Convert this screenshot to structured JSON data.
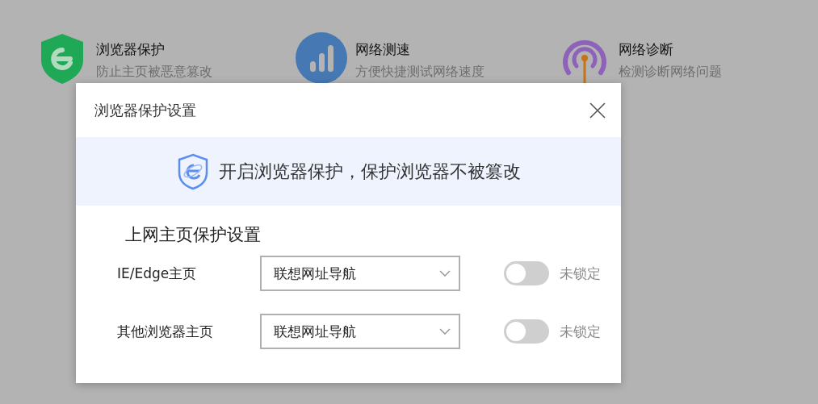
{
  "features": [
    {
      "kind": "shield",
      "title": "浏览器保护",
      "subtitle": "防止主页被恶意篡改"
    },
    {
      "kind": "speed",
      "title": "网络测速",
      "subtitle": "方便快捷测试网络速度"
    },
    {
      "kind": "signal",
      "title": "网络诊断",
      "subtitle": "检测诊断网络问题"
    }
  ],
  "dialog": {
    "title": "浏览器保护设置",
    "banner": "开启浏览器保护，保护浏览器不被篡改",
    "section_title": "上网主页保护设置",
    "rows": [
      {
        "label": "IE/Edge主页",
        "value": "联想网址导航",
        "locked": false,
        "status": "未锁定"
      },
      {
        "label": "其他浏览器主页",
        "value": "联想网址导航",
        "locked": false,
        "status": "未锁定"
      }
    ]
  }
}
